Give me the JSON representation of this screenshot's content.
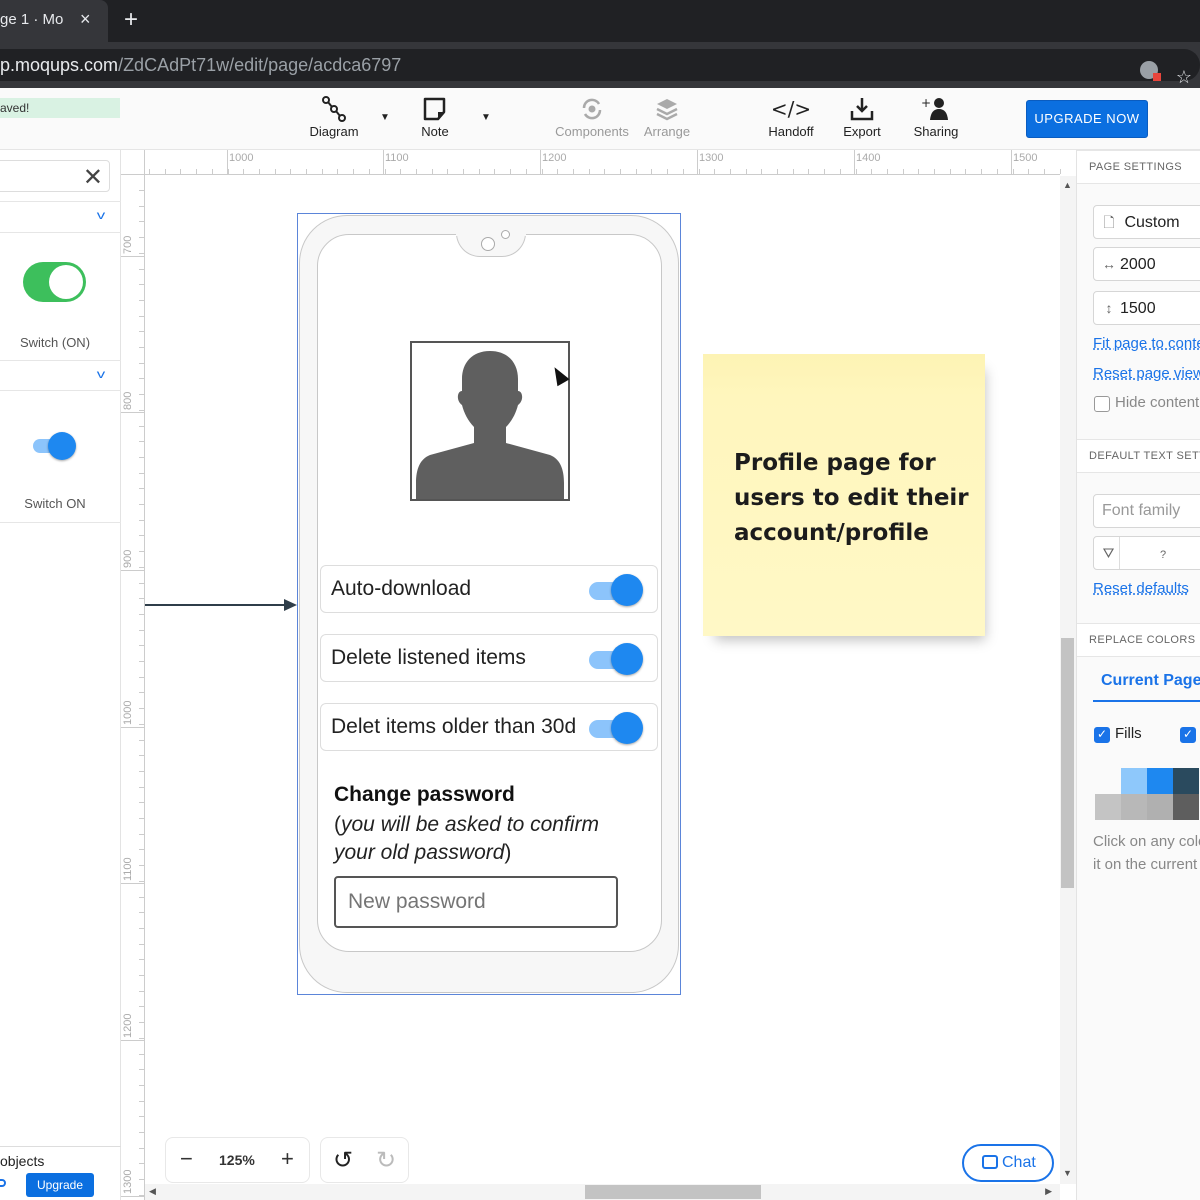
{
  "browser": {
    "tab_title_visible": "ge 1 · Mo",
    "tab_close": "×",
    "new_tab": "+",
    "url_host": "p.moqups.com",
    "url_path": "/ZdCAdPt71w/edit/page/acdca6797"
  },
  "toolbar": {
    "save_status": "aved!",
    "tools": [
      {
        "label": "Diagram",
        "icon": "diagram-icon",
        "enabled": true
      },
      {
        "label": "Note",
        "icon": "note-icon",
        "enabled": true
      },
      {
        "label": "Components",
        "icon": "components-icon",
        "enabled": false
      },
      {
        "label": "Arrange",
        "icon": "arrange-icon",
        "enabled": false
      },
      {
        "label": "Handoff",
        "icon": "handoff-icon",
        "enabled": true
      },
      {
        "label": "Export",
        "icon": "export-icon",
        "enabled": true
      },
      {
        "label": "Sharing",
        "icon": "sharing-icon",
        "enabled": true
      }
    ],
    "upgrade_label": "UPGRADE NOW"
  },
  "left_panel": {
    "close": "✕",
    "stencils": [
      {
        "label": "Switch (ON)",
        "type": "ios-switch",
        "color": "#3dbf5c"
      },
      {
        "label": "Switch ON",
        "type": "material-switch",
        "color": "#1e88f0"
      }
    ],
    "footer_text": "objects",
    "upgrade_label": "Upgrade"
  },
  "rulers": {
    "horizontal": [
      "1000",
      "1100",
      "1200",
      "1300",
      "1400",
      "1500"
    ],
    "vertical": [
      "700",
      "800",
      "900",
      "1000",
      "1100",
      "1200",
      "1300"
    ]
  },
  "mockup": {
    "settings": [
      {
        "label": "Auto-download",
        "on": true
      },
      {
        "label": "Delete listened items",
        "on": true
      },
      {
        "label": "Delet items older than 30d",
        "on": true
      }
    ],
    "password_title": "Change password",
    "password_note_open": "(",
    "password_note_italic": "you will be asked to confirm your old password",
    "password_note_close": ")",
    "password_placeholder": "New password"
  },
  "sticky_note": {
    "text": "Profile page for users to edit their account/profile"
  },
  "bottom": {
    "zoom_minus": "−",
    "zoom_level": "125%",
    "zoom_plus": "+",
    "undo": "↺",
    "redo": "↻",
    "chat_label": "Chat"
  },
  "right_panel": {
    "page_settings_header": "PAGE SETTINGS",
    "page_size_preset": "Custom",
    "width": "2000",
    "height": "1500",
    "fit_link": "Fit page to content",
    "reset_link": "Reset page view",
    "hide_content_label": "Hide content",
    "text_settings_header": "DEFAULT TEXT SETTINGS",
    "font_family_placeholder": "Font family",
    "font_size_value": "?",
    "reset_defaults_link": "Reset defaults",
    "replace_colors_header": "REPLACE COLORS",
    "current_page_tab": "Current Page",
    "fills_label": "Fills",
    "swatches_row1": [
      "#8ec8fb",
      "#1e88f0",
      "#2a4a5e"
    ],
    "swatches_row2": [
      "#c4c4c4",
      "#b8b8b8",
      "#b0b0b0",
      "#5e5e5e"
    ],
    "help_text": "Click on any color to replace it on the current page"
  }
}
